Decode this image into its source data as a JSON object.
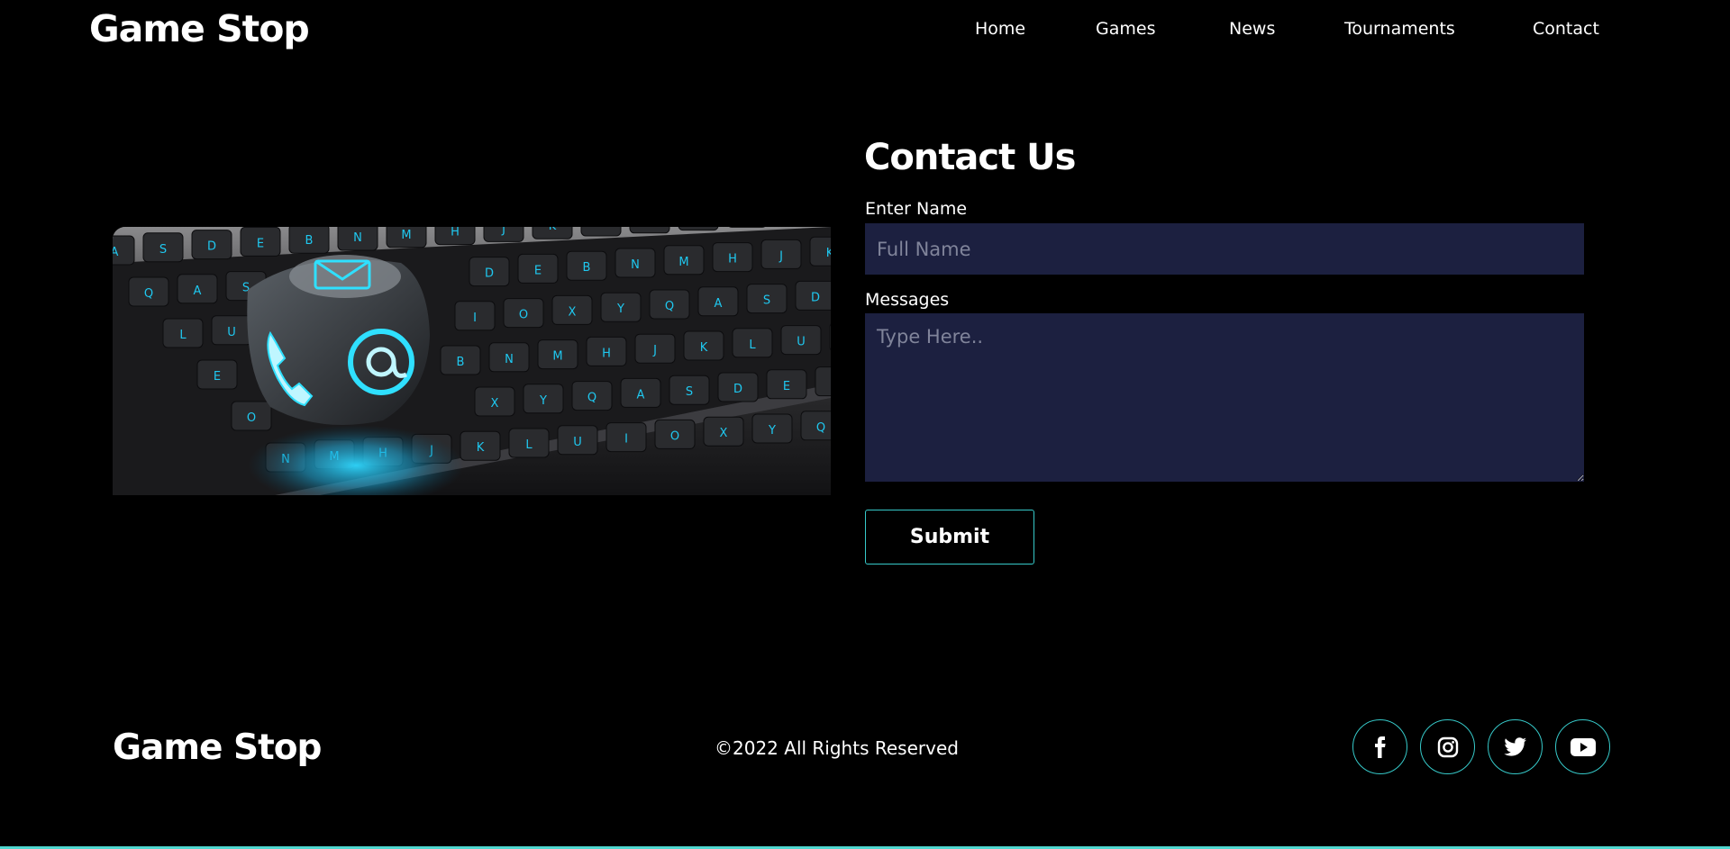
{
  "header": {
    "logo": "Game Stop",
    "nav": [
      "Home",
      "Games",
      "News",
      "Tournaments",
      "Contact"
    ]
  },
  "illustration": {
    "icons": [
      "envelope-icon",
      "phone-icon",
      "at-sign-icon"
    ],
    "keyboard_legends": [
      "A",
      "S",
      "D",
      "E",
      "B",
      "N",
      "M",
      "H",
      "J",
      "K",
      "L",
      "U",
      "I",
      "O",
      "X",
      "Y",
      "Q"
    ]
  },
  "contact": {
    "title": "Contact Us",
    "name_label": "Enter Name",
    "name_placeholder": "Full Name",
    "name_value": "",
    "message_label": "Messages",
    "message_placeholder": "Type Here..",
    "message_value": "",
    "submit_label": "Submit"
  },
  "footer": {
    "logo": "Game Stop",
    "copyright": "©2022 All Rights Reserved",
    "social": [
      "facebook-icon",
      "instagram-icon",
      "twitter-icon",
      "youtube-icon"
    ]
  },
  "colors": {
    "background": "#000000",
    "accent": "#36c9c9",
    "input_bg": "#1c2040",
    "glow": "#1fc8f0"
  }
}
